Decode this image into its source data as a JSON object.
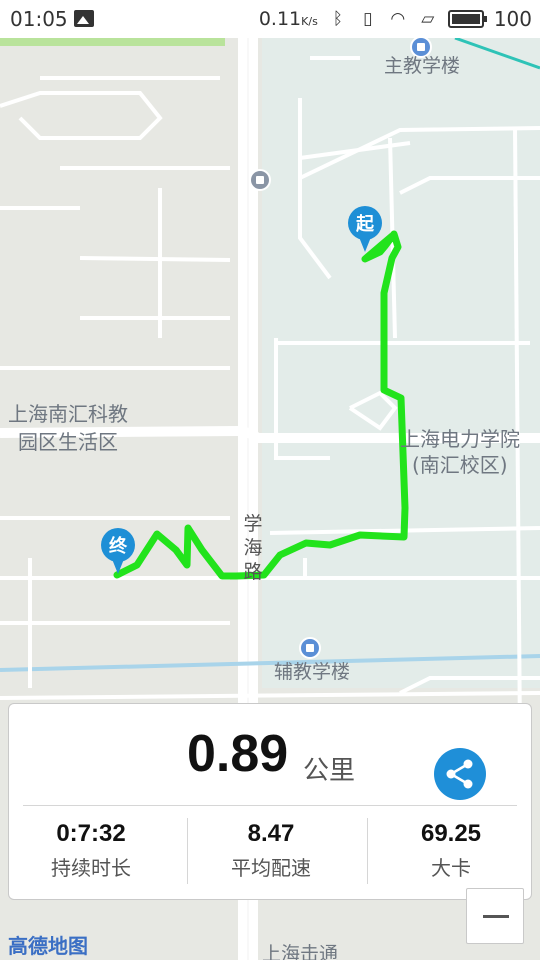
{
  "status_bar": {
    "time": "01:05",
    "network_speed": "0.11",
    "network_unit": "K/s",
    "battery": "100"
  },
  "map": {
    "labels": {
      "main_building": "主教学楼",
      "area_line1": "上海南汇科教",
      "area_line2": "园区生活区",
      "university_line1": "上海电力学院",
      "university_line2": "(南汇校区)",
      "road_name": [
        "学",
        "海",
        "路"
      ],
      "aux_building": "辅教学楼",
      "bottom_cut": "上海击通"
    },
    "start_marker": "起",
    "end_marker": "终",
    "route_color": "#22e31c"
  },
  "stats": {
    "distance": "0.89",
    "distance_unit": "公里",
    "duration": "0:7:32",
    "duration_label": "持续时长",
    "pace": "8.47",
    "pace_label": "平均配速",
    "calories": "69.25",
    "calories_label": "大卡"
  },
  "brand": "高德地图",
  "colors": {
    "accent": "#1f8fd8",
    "route": "#22e31c"
  }
}
